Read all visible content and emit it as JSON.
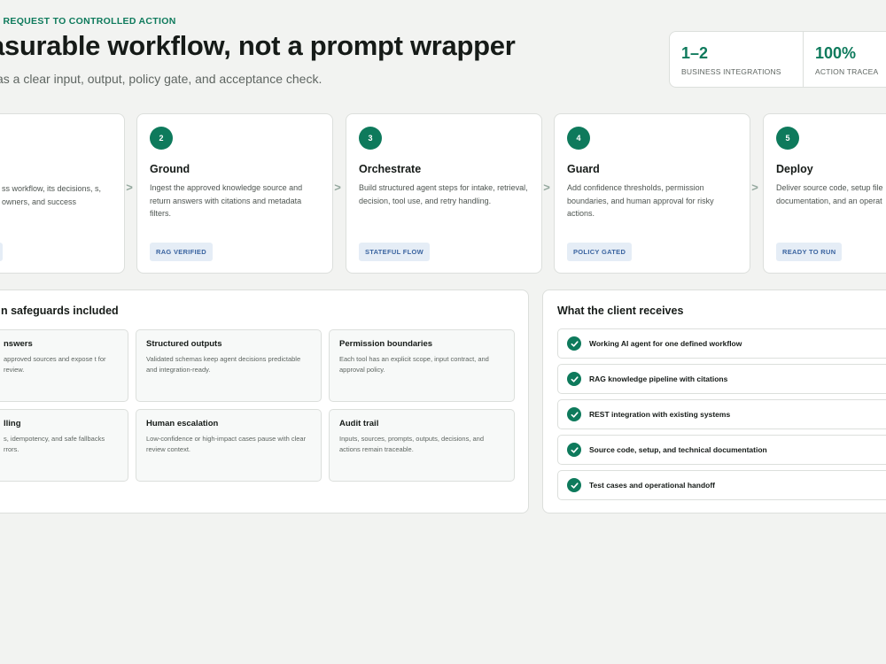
{
  "eyebrow": "S REQUEST TO CONTROLLED ACTION",
  "headline": "asurable workflow, not a prompt wrapper",
  "subhead": "as a clear input, output, policy gate, and acceptance check.",
  "stats": [
    {
      "value": "1–2",
      "label": "BUSINESS INTEGRATIONS"
    },
    {
      "value": "100%",
      "label": "ACTION TRACEA"
    }
  ],
  "steps": [
    {
      "number": "",
      "title": "",
      "desc": "ss workflow, its decisions, s, owners, and success",
      "tag": "D"
    },
    {
      "number": "2",
      "title": "Ground",
      "desc": "Ingest the approved knowledge source and return answers with citations and metadata filters.",
      "tag": "RAG VERIFIED"
    },
    {
      "number": "3",
      "title": "Orchestrate",
      "desc": "Build structured agent steps for intake, retrieval, decision, tool use, and retry handling.",
      "tag": "STATEFUL FLOW"
    },
    {
      "number": "4",
      "title": "Guard",
      "desc": "Add confidence thresholds, permission boundaries, and human approval for risky actions.",
      "tag": "POLICY GATED"
    },
    {
      "number": "5",
      "title": "Deploy",
      "desc": "Deliver source code, setup file documentation, and an operat",
      "tag": "READY TO RUN"
    }
  ],
  "arrow_glyph": ">",
  "safeguards": {
    "title": "n safeguards included",
    "cards": [
      {
        "title": "nswers",
        "desc": "approved sources and expose t for review."
      },
      {
        "title": "Structured outputs",
        "desc": "Validated schemas keep agent decisions predictable and integration-ready."
      },
      {
        "title": "Permission boundaries",
        "desc": "Each tool has an explicit scope, input contract, and approval policy."
      },
      {
        "title": "lling",
        "desc": "s, idempotency, and safe fallbacks rrors."
      },
      {
        "title": "Human escalation",
        "desc": "Low-confidence or high-impact cases pause with clear review context."
      },
      {
        "title": "Audit trail",
        "desc": "Inputs, sources, prompts, outputs, decisions, and actions remain traceable."
      }
    ]
  },
  "receives": {
    "title": "What the client receives",
    "items": [
      "Working AI agent for one defined workflow",
      "RAG knowledge pipeline with citations",
      "REST integration with existing systems",
      "Source code, setup, and technical documentation",
      "Test cases and operational handoff"
    ],
    "icon": "check-icon"
  },
  "colors": {
    "accent": "#0e7a5c",
    "tag_bg": "#e5edf6",
    "tag_text": "#3a64a0",
    "page_bg": "#f2f3f1"
  }
}
